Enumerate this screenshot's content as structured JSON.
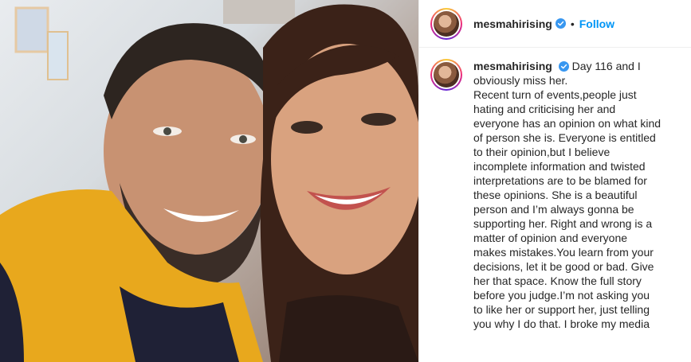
{
  "post": {
    "author": {
      "username": "mesmahirising",
      "verified": true,
      "follow_label": "Follow",
      "separator": "•"
    },
    "caption": {
      "username": "mesmahirising",
      "first_line": "Day 116 and I",
      "lines": [
        "obviously miss her.",
        "Recent turn of events,people just",
        "hating and criticising her and",
        "everyone has an opinion on what kind",
        "of person she is. Everyone is entitled",
        "to their opinion,but I believe",
        "incomplete information and twisted",
        "interpretations are to be blamed for",
        "these opinions. She is a beautiful",
        "person and I’m always gonna be",
        "supporting her. Right and wrong is a",
        "matter of opinion and everyone",
        "makes mistakes.You learn from your",
        "decisions, let it be good or bad. Give",
        "her that space. Know the full story",
        "before you judge.I’m not asking you",
        "to like her or support her, just telling",
        "you why I do that. I broke my media"
      ]
    },
    "colors": {
      "accent": "#0095f6",
      "text": "#262626",
      "border": "#efefef"
    },
    "icons": {
      "verified": "verified-badge-icon"
    }
  }
}
